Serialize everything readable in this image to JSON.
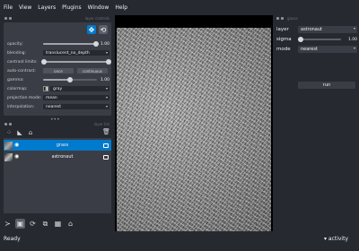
{
  "menubar": {
    "items": [
      "File",
      "View",
      "Layers",
      "Plugins",
      "Window",
      "Help"
    ]
  },
  "left_panel": {
    "dock_title": "layer controls",
    "controls": {
      "opacity": {
        "label": "opacity:",
        "value": "1.00",
        "level": 1.0
      },
      "blending": {
        "label": "blending:",
        "value": "translucent_no_depth"
      },
      "contrast_limits": {
        "label": "contrast limits:",
        "level_low": 0.0,
        "level_high": 1.0
      },
      "auto_contrast": {
        "label": "auto-contrast:",
        "once": "once",
        "continuous": "continuous"
      },
      "gamma": {
        "label": "gamma:",
        "value": "1.00",
        "level": 0.5
      },
      "colormap": {
        "label": "colormap:",
        "value": "gray"
      },
      "projection_mode": {
        "label": "projection mode:",
        "value": "mean"
      },
      "interpolation": {
        "label": "interpolation:",
        "value": "nearest"
      }
    },
    "layer_list_title": "layer list",
    "layers": [
      {
        "name": "grass",
        "selected": true
      },
      {
        "name": "astronaut",
        "selected": false
      }
    ]
  },
  "right_panel": {
    "dock_title": "gauss",
    "layer": {
      "label": "layer",
      "value": "astronaut"
    },
    "sigma": {
      "label": "sigma",
      "value": "1.00",
      "level": 0.05
    },
    "mode": {
      "label": "mode",
      "value": "nearest"
    },
    "run_label": "run"
  },
  "statusbar": {
    "status": "Ready",
    "activity": "activity"
  },
  "colors": {
    "accent": "#007acc",
    "background": "#262930",
    "panel": "#3a3d45"
  }
}
